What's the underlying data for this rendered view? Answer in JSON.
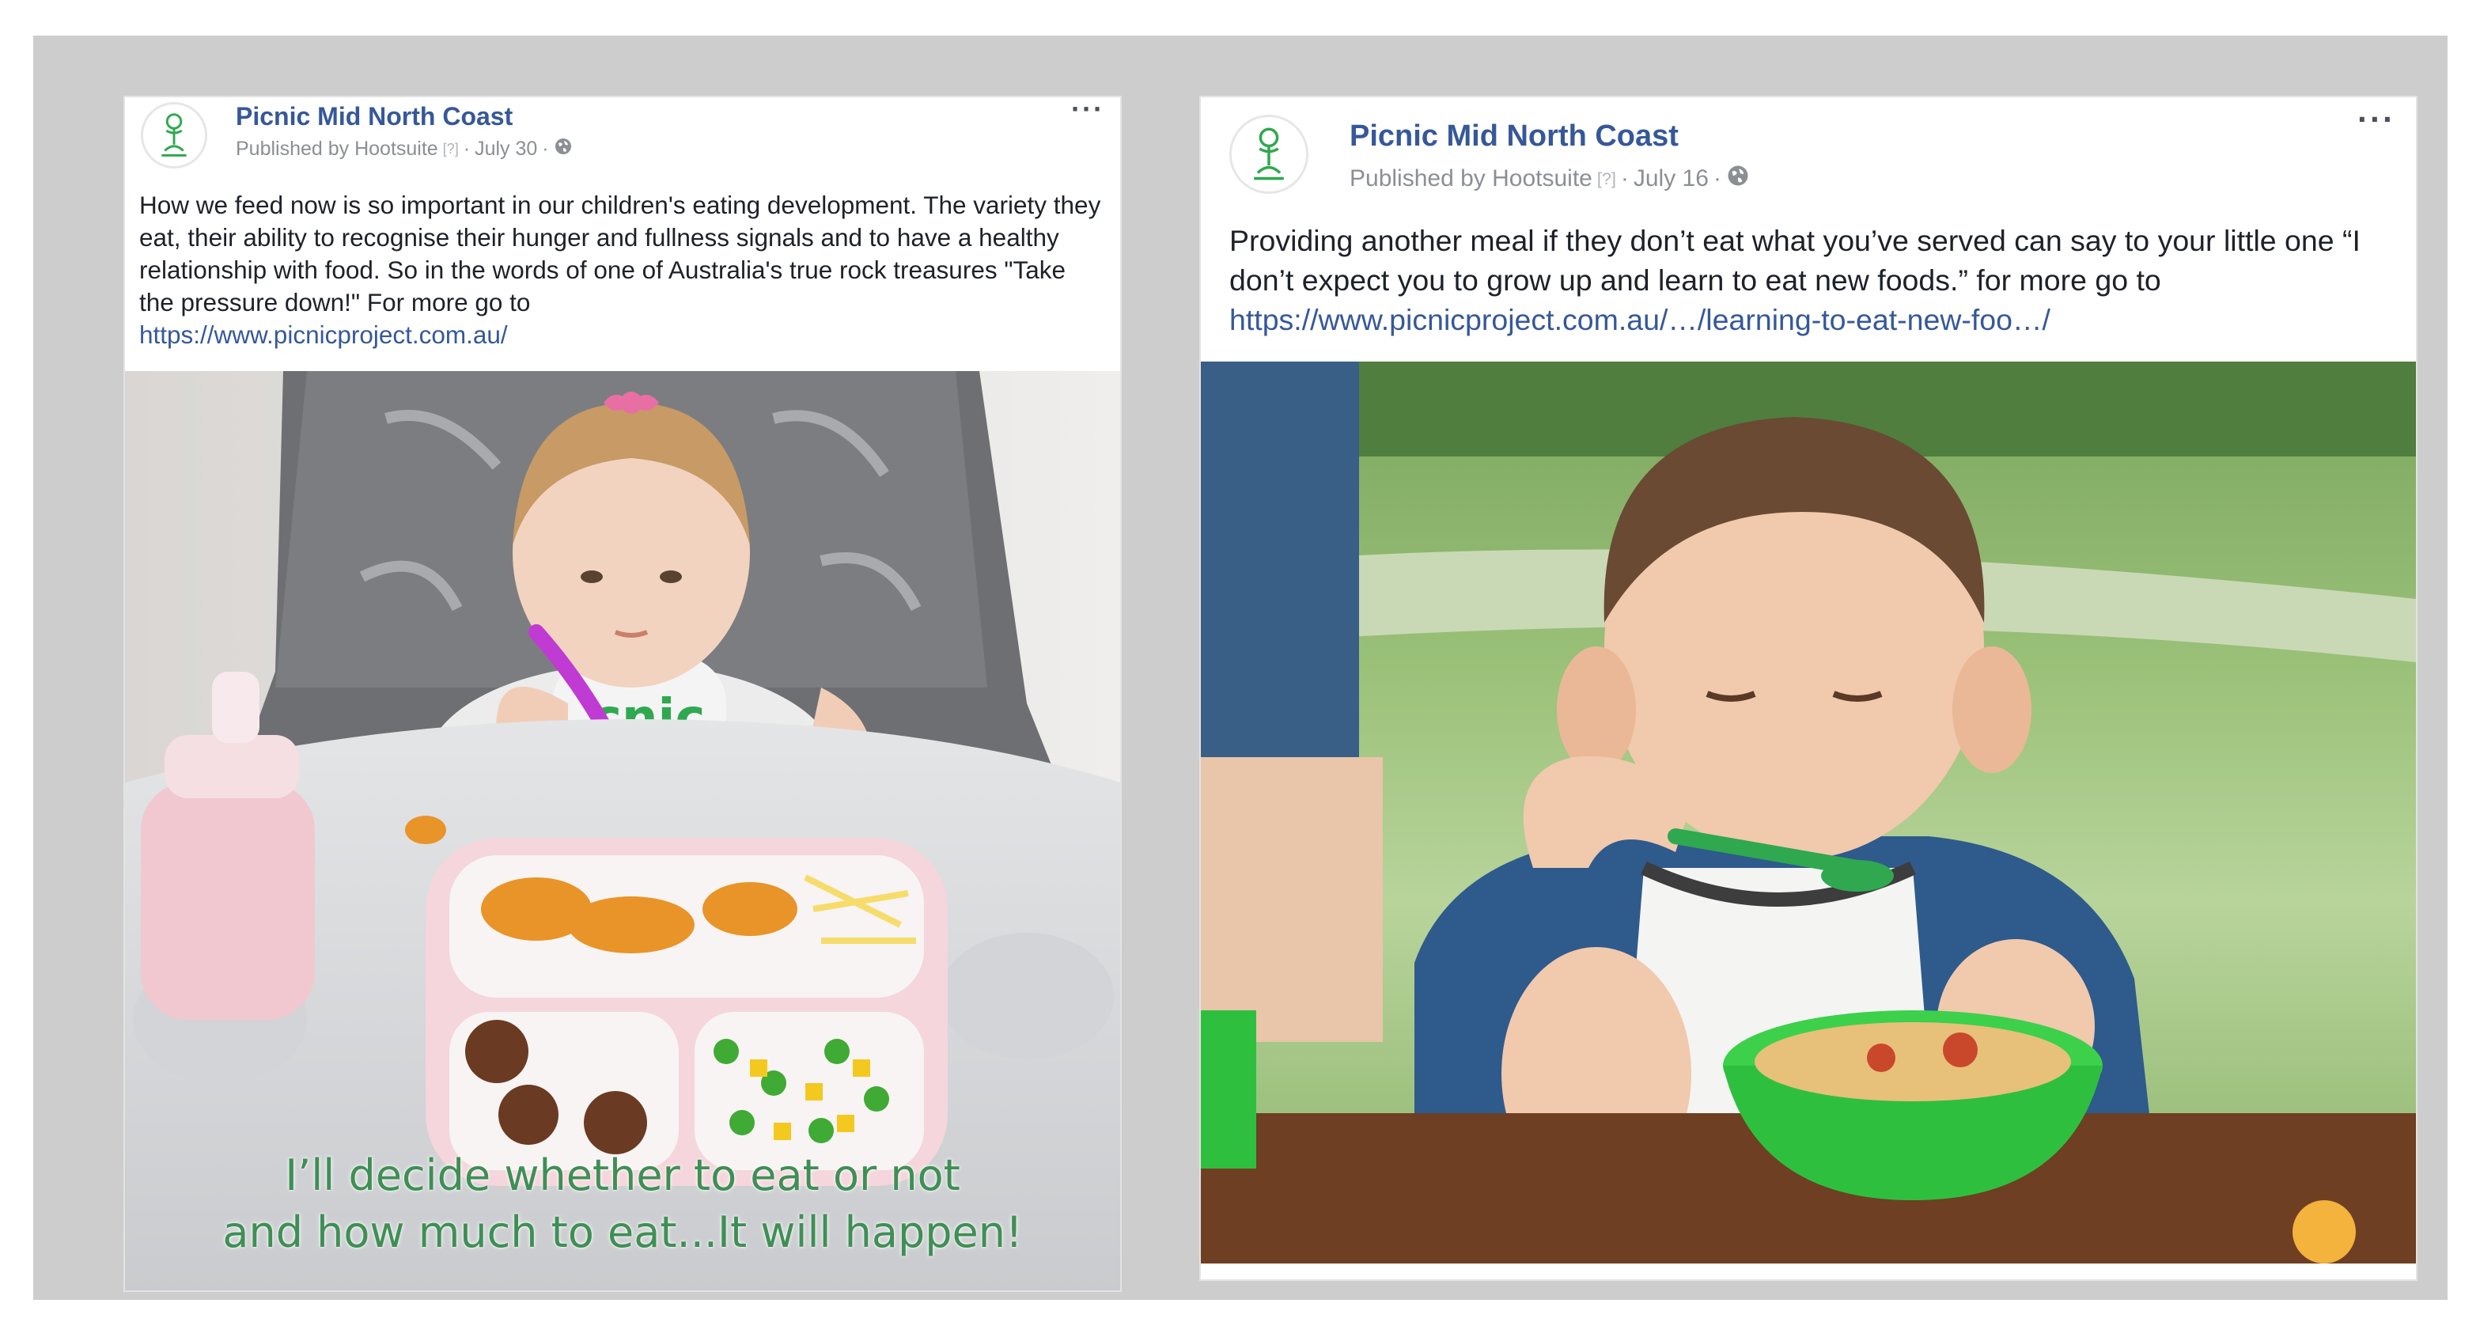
{
  "posts": [
    {
      "page_name": "Picnic Mid North Coast",
      "published_by": "Published by Hootsuite",
      "help_mark": "[?]",
      "date": "July 30",
      "separator": "·",
      "text": "How we feed now is so important in our children's eating development. The variety they eat, their ability to recognise their hunger and fullness signals and to have a healthy relationship with food. So in the words of one of Australia's true rock treasures \"Take the pressure down!\" For more go to",
      "link": "https://www.picnicproject.com.au/",
      "photo_caption_line1": "I’ll decide whether to eat or not",
      "photo_caption_line2": "and how much to eat...It will happen!",
      "bib_text": "cnic",
      "more_label": "···"
    },
    {
      "page_name": "Picnic Mid North Coast",
      "published_by": "Published by Hootsuite",
      "help_mark": "[?]",
      "date": "July 16",
      "separator": "·",
      "text": "Providing another meal if they don’t eat what you’ve served can say to your little one “I don’t expect you to grow up and learn to eat new foods.” for more go to",
      "link": "https://www.picnicproject.com.au/…/learning-to-eat-new-foo…/",
      "more_label": "···"
    }
  ],
  "icons": {
    "avatar": "picnic-logo-icon",
    "more": "more-options-icon",
    "privacy": "globe-icon"
  },
  "colors": {
    "link": "#365899",
    "meta": "#8b8f94",
    "caption": "#3f8f55",
    "logo_green": "#2fa84f"
  }
}
